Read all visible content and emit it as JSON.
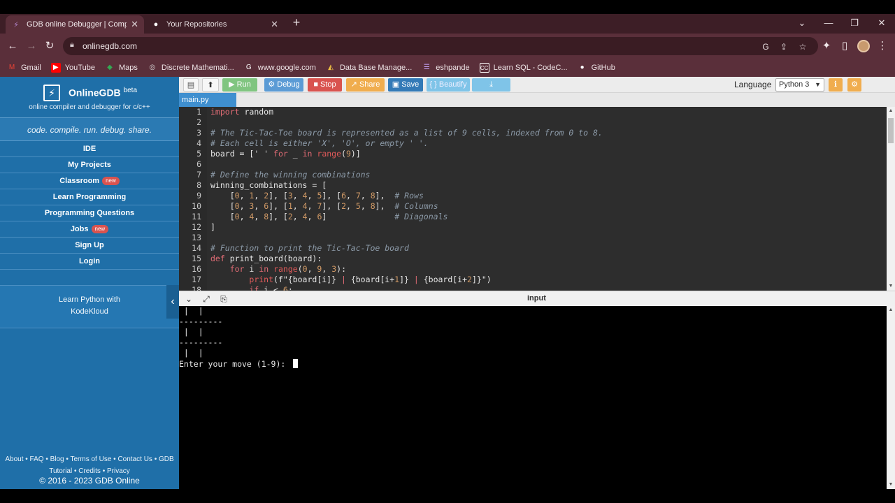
{
  "browser": {
    "tabs": [
      {
        "label": "GDB online Debugger | Compile",
        "active": true
      },
      {
        "label": "Your Repositories",
        "active": false
      }
    ],
    "url": "onlinegdb.com",
    "bookmarks": [
      "Gmail",
      "YouTube",
      "Maps",
      "Discrete Mathemati...",
      "www.google.com",
      "Data Base Manage...",
      "eshpande",
      "Learn SQL - CodeC...",
      "GitHub"
    ]
  },
  "sidebar": {
    "brand": "OnlineGDB",
    "beta": "beta",
    "subtitle": "online compiler and debugger for c/c++",
    "tagline": "code. compile. run. debug. share.",
    "menu": [
      {
        "label": "IDE"
      },
      {
        "label": "My Projects"
      },
      {
        "label": "Classroom",
        "badge": "new"
      },
      {
        "label": "Learn Programming"
      },
      {
        "label": "Programming Questions"
      },
      {
        "label": "Jobs",
        "badge": "new"
      },
      {
        "label": "Sign Up"
      },
      {
        "label": "Login"
      }
    ],
    "promo_line1": "Learn Python with",
    "promo_line2": "KodeKloud",
    "footer_line1": "About • FAQ • Blog • Terms of Use • Contact Us • GDB",
    "footer_line2": "Tutorial • Credits • Privacy",
    "copyright": "© 2016 - 2023 GDB Online"
  },
  "toolbar": {
    "run": "Run",
    "debug": "Debug",
    "stop": "Stop",
    "share": "Share",
    "save": "Save",
    "beautify": "{ } Beautify",
    "language_label": "Language",
    "language_value": "Python 3"
  },
  "editor": {
    "file_tab": "main.py"
  },
  "console": {
    "title": "input",
    "lines": [
      " |  | ",
      "---------",
      " |  | ",
      "---------",
      " |  | "
    ],
    "prompt": "Enter your move (1-9): "
  },
  "colors": {
    "sidebar": "#1f6fa8",
    "run": "#5cb85c",
    "debug": "#5b9bd5",
    "stop": "#d9534f",
    "share": "#f0ad4e",
    "save": "#337ab7",
    "beautify": "#7fc4e8"
  }
}
